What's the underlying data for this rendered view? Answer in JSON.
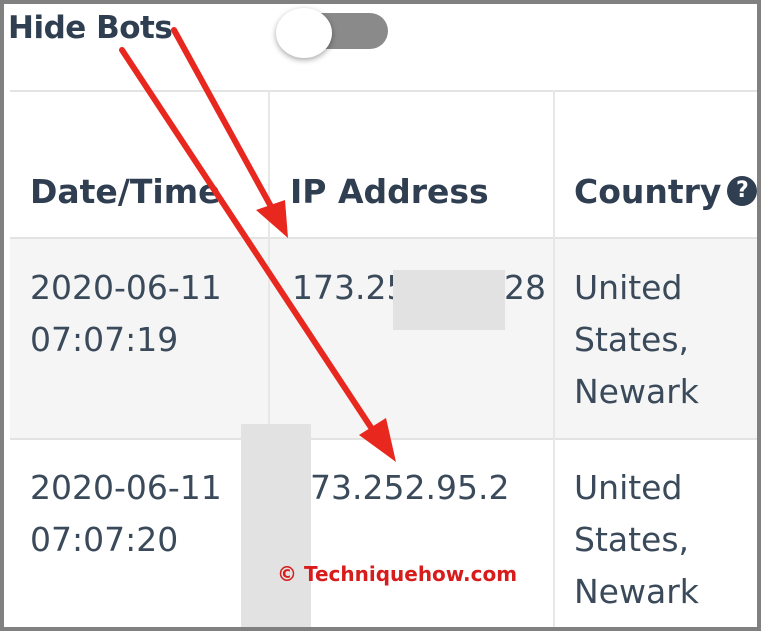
{
  "toolbar": {
    "hide_bots_label": "Hide Bots",
    "hide_bots_toggle_state": "off"
  },
  "table": {
    "headers": {
      "datetime": "Date/Time",
      "ip": "IP Address",
      "country": "Country"
    },
    "rows": [
      {
        "date": "2020-06-11",
        "time": "07:07:19",
        "ip": "173.25",
        "ip_suffix": "28",
        "country_line1": "United",
        "country_line2": "States,",
        "country_line3": "Newark"
      },
      {
        "date": "2020-06-11",
        "time": "07:07:20",
        "ip": "73.252.95.2",
        "country_line1": "United",
        "country_line2": "States,",
        "country_line3": "Newark"
      }
    ]
  },
  "watermark": "© Techniquehow.com",
  "colors": {
    "header_text": "#2f3e50",
    "arrow": "#e8281e",
    "watermark": "#d81b1b",
    "stripe": "#f5f5f5"
  }
}
